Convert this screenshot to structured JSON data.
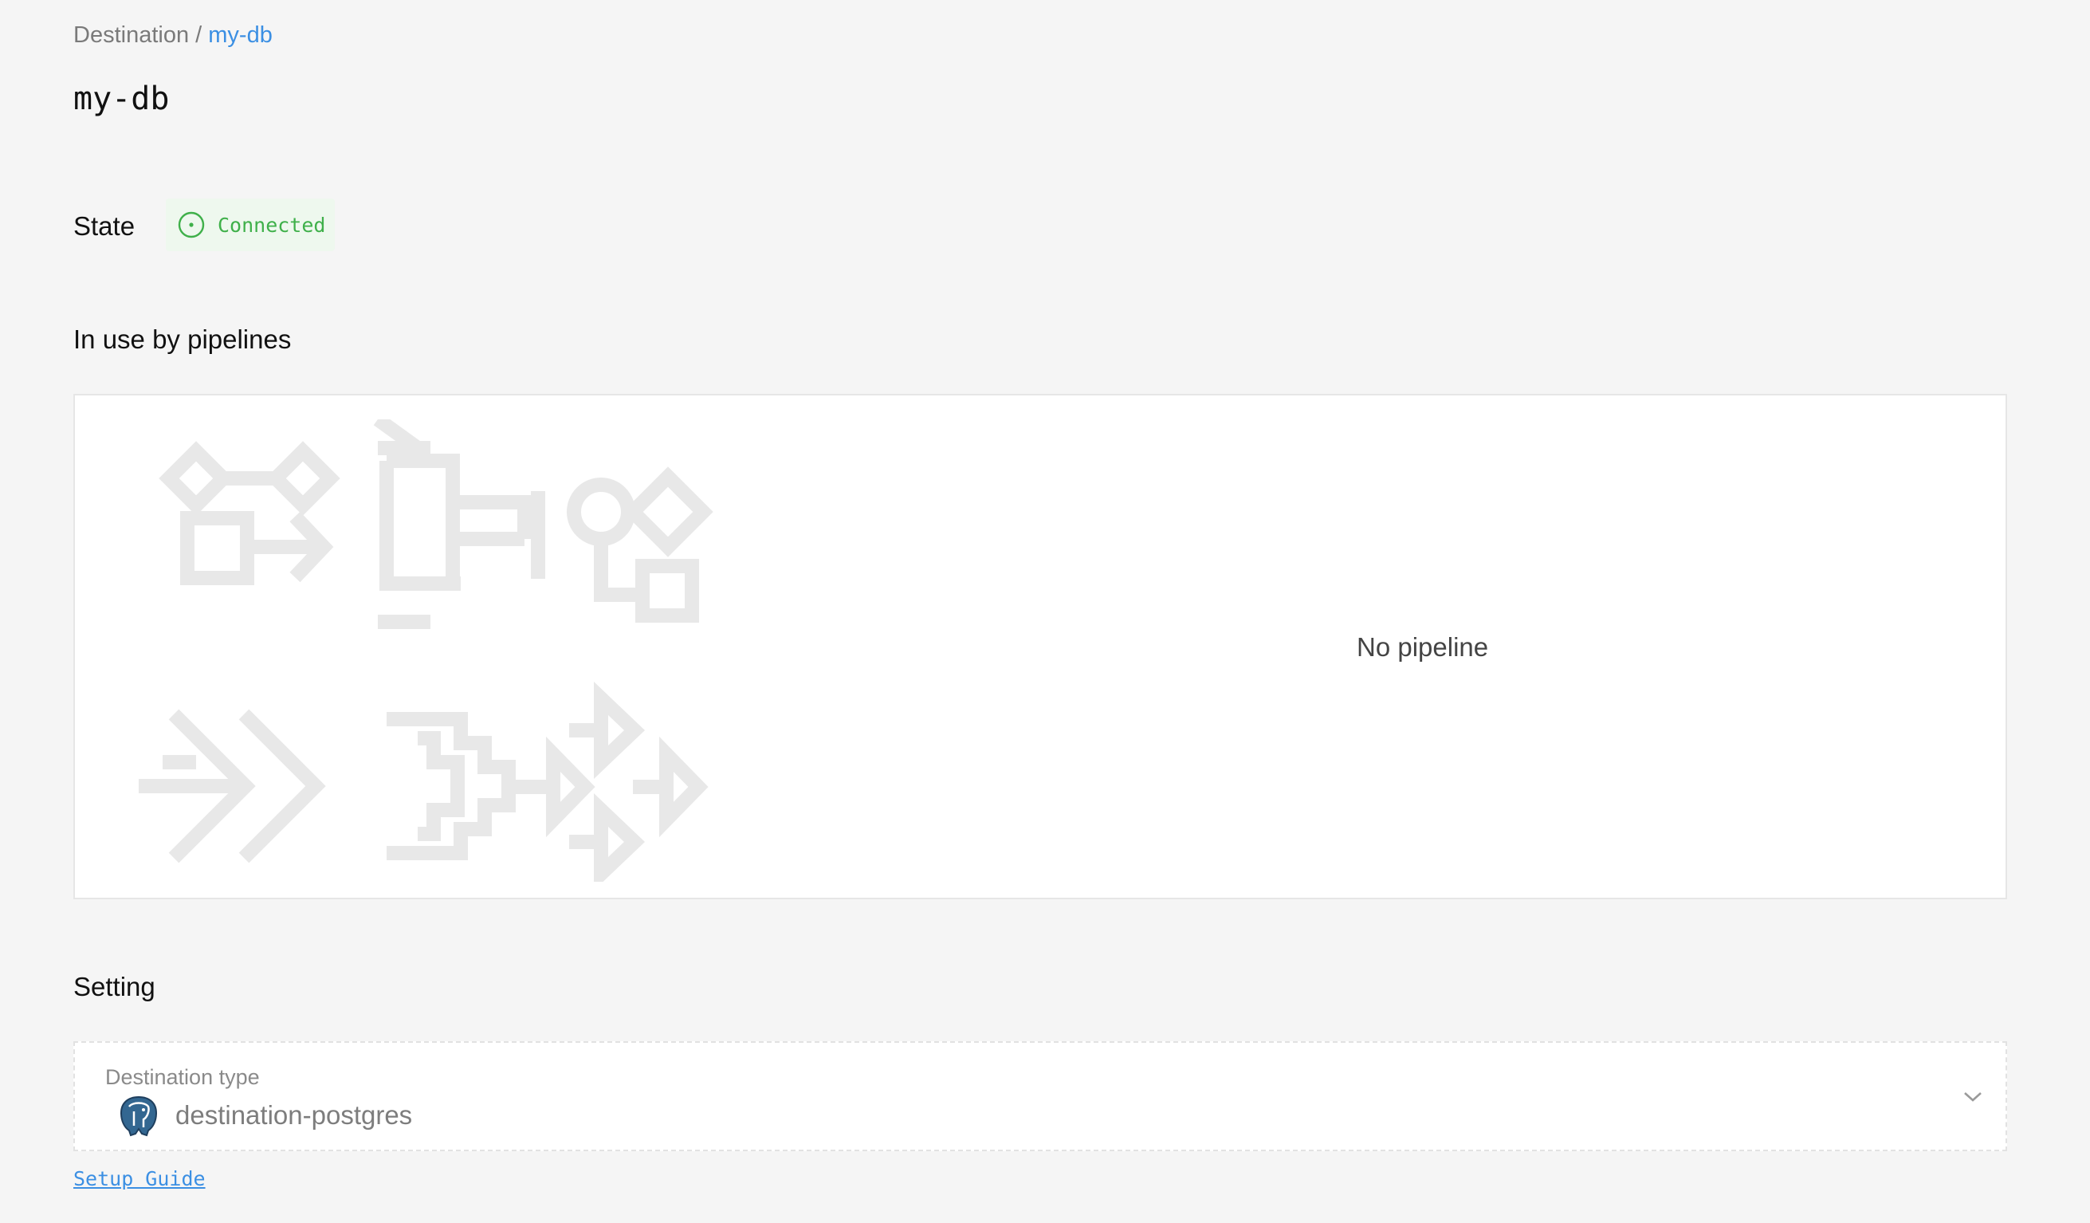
{
  "breadcrumb": {
    "parent": "Destination",
    "separator": " / ",
    "current": "my-db"
  },
  "page": {
    "title": "my-db"
  },
  "state": {
    "label": "State",
    "status": "Connected",
    "status_color": "#3fb04a",
    "status_icon": "dot-circle-icon"
  },
  "pipelines": {
    "heading": "In use by pipelines",
    "empty_text": "No pipeline"
  },
  "setting": {
    "heading": "Setting",
    "destination_type_label": "Destination type",
    "destination_type_value": "destination-postgres",
    "destination_type_icon": "postgres-elephant-icon"
  },
  "links": {
    "setup_guide": "Setup Guide"
  },
  "colors": {
    "accent": "#3b8fe3",
    "background": "#f5f5f5",
    "illustration": "#e8e8e8"
  }
}
